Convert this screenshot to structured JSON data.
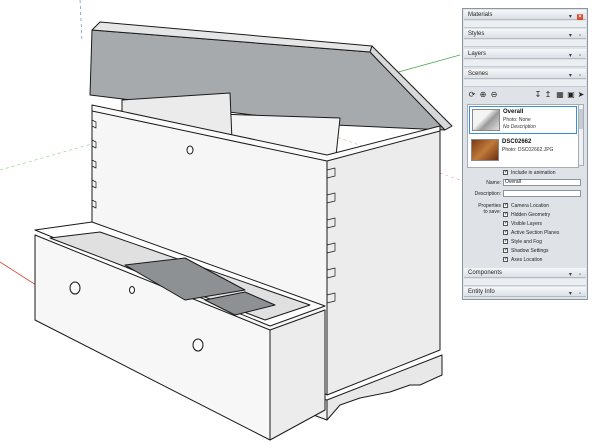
{
  "tray": {
    "materials": {
      "title": "Materials"
    },
    "styles": {
      "title": "Styles"
    },
    "layers": {
      "title": "Layers"
    },
    "scenes": {
      "title": "Scenes",
      "list": [
        {
          "name": "Overall",
          "photo": "Photo: None",
          "description": "No Description",
          "selected": true
        },
        {
          "name": "DSC02662",
          "photo": "Photo: DSC02662.JPG",
          "description": "",
          "selected": false
        }
      ],
      "include_in_animation": "Include in animation",
      "name_label": "Name:",
      "name_value": "Overall",
      "description_label": "Description:",
      "description_value": "",
      "properties_label_1": "Properties",
      "properties_label_2": "to save:",
      "properties": [
        {
          "label": "Camera Location",
          "checked": true
        },
        {
          "label": "Hidden Geometry",
          "checked": true
        },
        {
          "label": "Visible Layers",
          "checked": true
        },
        {
          "label": "Active Section Planes",
          "checked": true
        },
        {
          "label": "Style and Fog",
          "checked": true
        },
        {
          "label": "Shadow Settings",
          "checked": true
        },
        {
          "label": "Axes Location",
          "checked": true
        }
      ]
    },
    "components": {
      "title": "Components"
    },
    "entity_info": {
      "title": "Entity Info"
    }
  },
  "colors": {
    "tray_bg": "#dfe3e8",
    "selection": "#3b8de0",
    "axis_red": "#d64a3a",
    "axis_green": "#4daa4d",
    "model_line": "#1a1a1a",
    "model_face": "#f4f4f4",
    "lid_face": "#a7aaad"
  }
}
